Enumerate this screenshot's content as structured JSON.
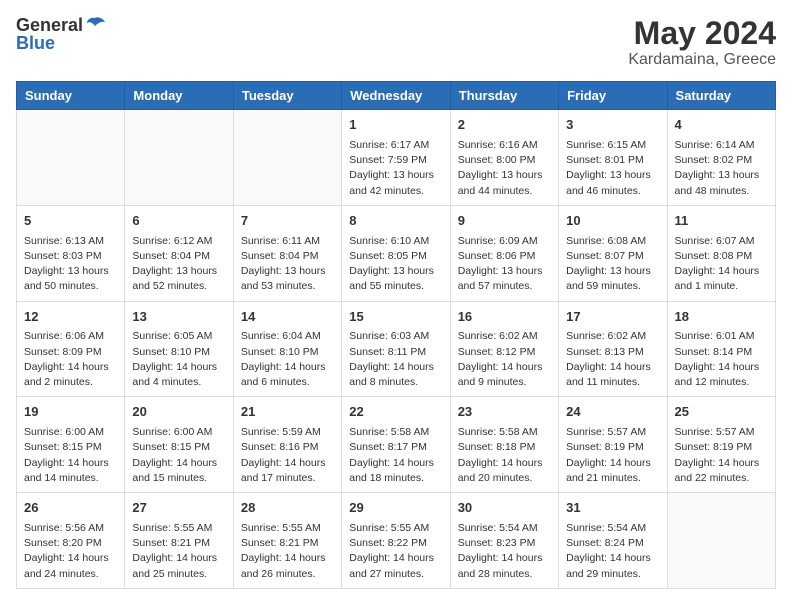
{
  "header": {
    "logo_general": "General",
    "logo_blue": "Blue",
    "month_year": "May 2024",
    "location": "Kardamaina, Greece"
  },
  "weekdays": [
    "Sunday",
    "Monday",
    "Tuesday",
    "Wednesday",
    "Thursday",
    "Friday",
    "Saturday"
  ],
  "weeks": [
    [
      {
        "day": "",
        "sunrise": "",
        "sunset": "",
        "daylight": "",
        "empty": true
      },
      {
        "day": "",
        "sunrise": "",
        "sunset": "",
        "daylight": "",
        "empty": true
      },
      {
        "day": "",
        "sunrise": "",
        "sunset": "",
        "daylight": "",
        "empty": true
      },
      {
        "day": "1",
        "sunrise": "Sunrise: 6:17 AM",
        "sunset": "Sunset: 7:59 PM",
        "daylight": "Daylight: 13 hours and 42 minutes."
      },
      {
        "day": "2",
        "sunrise": "Sunrise: 6:16 AM",
        "sunset": "Sunset: 8:00 PM",
        "daylight": "Daylight: 13 hours and 44 minutes."
      },
      {
        "day": "3",
        "sunrise": "Sunrise: 6:15 AM",
        "sunset": "Sunset: 8:01 PM",
        "daylight": "Daylight: 13 hours and 46 minutes."
      },
      {
        "day": "4",
        "sunrise": "Sunrise: 6:14 AM",
        "sunset": "Sunset: 8:02 PM",
        "daylight": "Daylight: 13 hours and 48 minutes."
      }
    ],
    [
      {
        "day": "5",
        "sunrise": "Sunrise: 6:13 AM",
        "sunset": "Sunset: 8:03 PM",
        "daylight": "Daylight: 13 hours and 50 minutes."
      },
      {
        "day": "6",
        "sunrise": "Sunrise: 6:12 AM",
        "sunset": "Sunset: 8:04 PM",
        "daylight": "Daylight: 13 hours and 52 minutes."
      },
      {
        "day": "7",
        "sunrise": "Sunrise: 6:11 AM",
        "sunset": "Sunset: 8:04 PM",
        "daylight": "Daylight: 13 hours and 53 minutes."
      },
      {
        "day": "8",
        "sunrise": "Sunrise: 6:10 AM",
        "sunset": "Sunset: 8:05 PM",
        "daylight": "Daylight: 13 hours and 55 minutes."
      },
      {
        "day": "9",
        "sunrise": "Sunrise: 6:09 AM",
        "sunset": "Sunset: 8:06 PM",
        "daylight": "Daylight: 13 hours and 57 minutes."
      },
      {
        "day": "10",
        "sunrise": "Sunrise: 6:08 AM",
        "sunset": "Sunset: 8:07 PM",
        "daylight": "Daylight: 13 hours and 59 minutes."
      },
      {
        "day": "11",
        "sunrise": "Sunrise: 6:07 AM",
        "sunset": "Sunset: 8:08 PM",
        "daylight": "Daylight: 14 hours and 1 minute."
      }
    ],
    [
      {
        "day": "12",
        "sunrise": "Sunrise: 6:06 AM",
        "sunset": "Sunset: 8:09 PM",
        "daylight": "Daylight: 14 hours and 2 minutes."
      },
      {
        "day": "13",
        "sunrise": "Sunrise: 6:05 AM",
        "sunset": "Sunset: 8:10 PM",
        "daylight": "Daylight: 14 hours and 4 minutes."
      },
      {
        "day": "14",
        "sunrise": "Sunrise: 6:04 AM",
        "sunset": "Sunset: 8:10 PM",
        "daylight": "Daylight: 14 hours and 6 minutes."
      },
      {
        "day": "15",
        "sunrise": "Sunrise: 6:03 AM",
        "sunset": "Sunset: 8:11 PM",
        "daylight": "Daylight: 14 hours and 8 minutes."
      },
      {
        "day": "16",
        "sunrise": "Sunrise: 6:02 AM",
        "sunset": "Sunset: 8:12 PM",
        "daylight": "Daylight: 14 hours and 9 minutes."
      },
      {
        "day": "17",
        "sunrise": "Sunrise: 6:02 AM",
        "sunset": "Sunset: 8:13 PM",
        "daylight": "Daylight: 14 hours and 11 minutes."
      },
      {
        "day": "18",
        "sunrise": "Sunrise: 6:01 AM",
        "sunset": "Sunset: 8:14 PM",
        "daylight": "Daylight: 14 hours and 12 minutes."
      }
    ],
    [
      {
        "day": "19",
        "sunrise": "Sunrise: 6:00 AM",
        "sunset": "Sunset: 8:15 PM",
        "daylight": "Daylight: 14 hours and 14 minutes."
      },
      {
        "day": "20",
        "sunrise": "Sunrise: 6:00 AM",
        "sunset": "Sunset: 8:15 PM",
        "daylight": "Daylight: 14 hours and 15 minutes."
      },
      {
        "day": "21",
        "sunrise": "Sunrise: 5:59 AM",
        "sunset": "Sunset: 8:16 PM",
        "daylight": "Daylight: 14 hours and 17 minutes."
      },
      {
        "day": "22",
        "sunrise": "Sunrise: 5:58 AM",
        "sunset": "Sunset: 8:17 PM",
        "daylight": "Daylight: 14 hours and 18 minutes."
      },
      {
        "day": "23",
        "sunrise": "Sunrise: 5:58 AM",
        "sunset": "Sunset: 8:18 PM",
        "daylight": "Daylight: 14 hours and 20 minutes."
      },
      {
        "day": "24",
        "sunrise": "Sunrise: 5:57 AM",
        "sunset": "Sunset: 8:19 PM",
        "daylight": "Daylight: 14 hours and 21 minutes."
      },
      {
        "day": "25",
        "sunrise": "Sunrise: 5:57 AM",
        "sunset": "Sunset: 8:19 PM",
        "daylight": "Daylight: 14 hours and 22 minutes."
      }
    ],
    [
      {
        "day": "26",
        "sunrise": "Sunrise: 5:56 AM",
        "sunset": "Sunset: 8:20 PM",
        "daylight": "Daylight: 14 hours and 24 minutes."
      },
      {
        "day": "27",
        "sunrise": "Sunrise: 5:55 AM",
        "sunset": "Sunset: 8:21 PM",
        "daylight": "Daylight: 14 hours and 25 minutes."
      },
      {
        "day": "28",
        "sunrise": "Sunrise: 5:55 AM",
        "sunset": "Sunset: 8:21 PM",
        "daylight": "Daylight: 14 hours and 26 minutes."
      },
      {
        "day": "29",
        "sunrise": "Sunrise: 5:55 AM",
        "sunset": "Sunset: 8:22 PM",
        "daylight": "Daylight: 14 hours and 27 minutes."
      },
      {
        "day": "30",
        "sunrise": "Sunrise: 5:54 AM",
        "sunset": "Sunset: 8:23 PM",
        "daylight": "Daylight: 14 hours and 28 minutes."
      },
      {
        "day": "31",
        "sunrise": "Sunrise: 5:54 AM",
        "sunset": "Sunset: 8:24 PM",
        "daylight": "Daylight: 14 hours and 29 minutes."
      },
      {
        "day": "",
        "sunrise": "",
        "sunset": "",
        "daylight": "",
        "empty": true
      }
    ]
  ]
}
